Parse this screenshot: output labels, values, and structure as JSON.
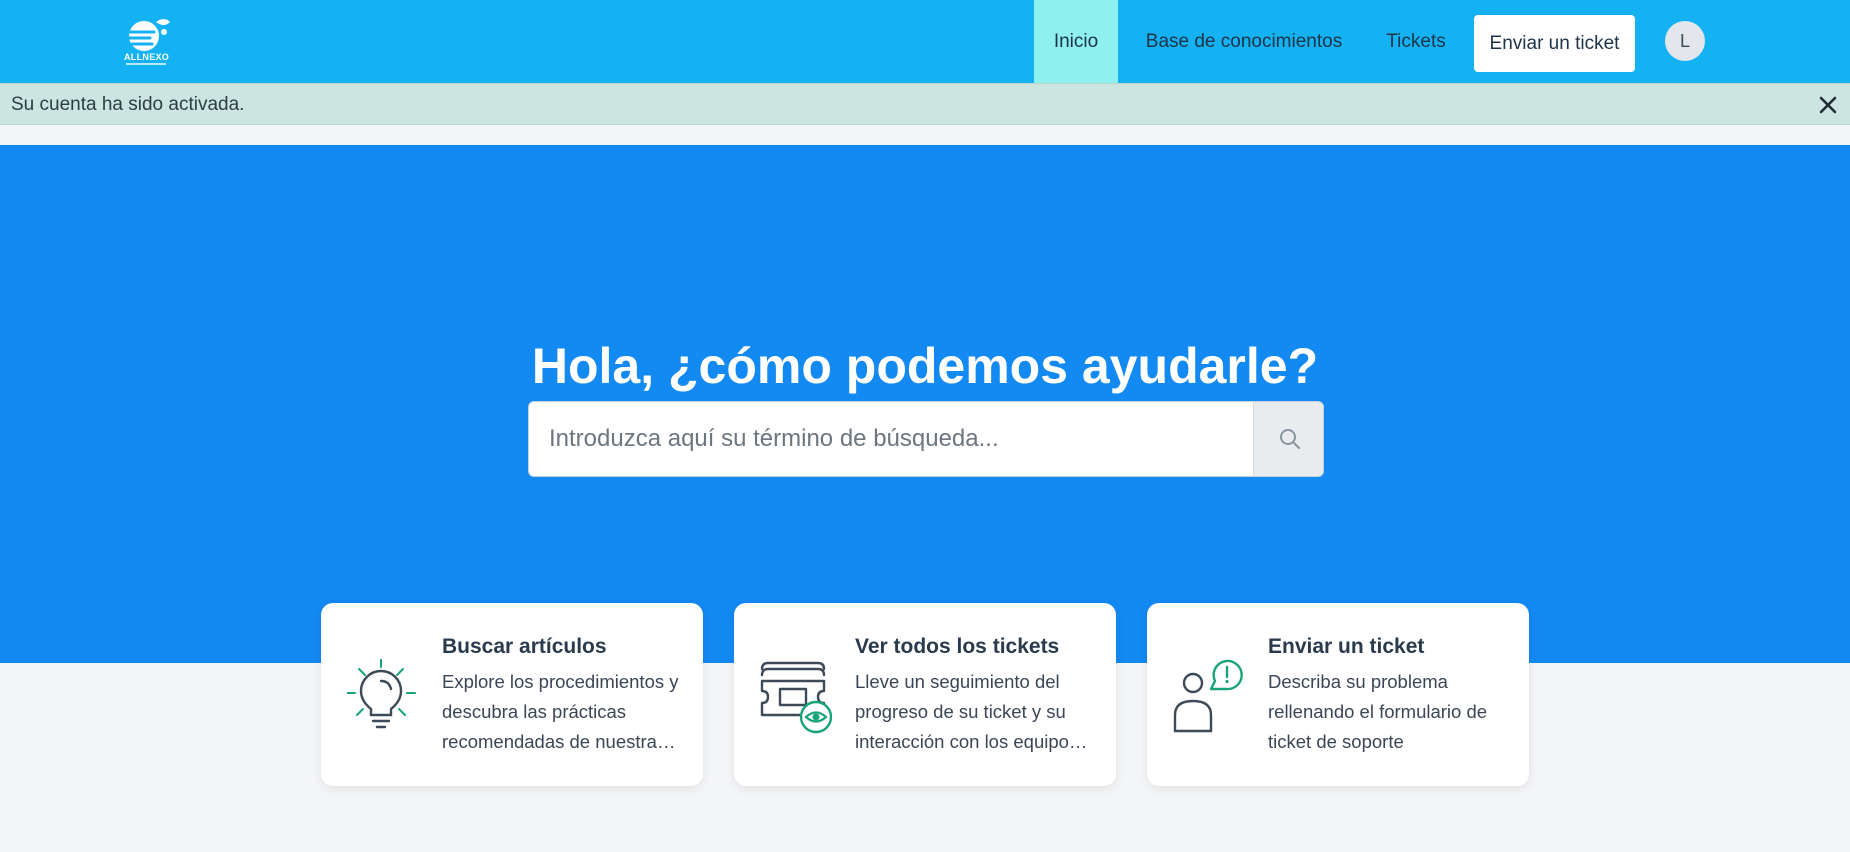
{
  "brand": {
    "name": "ALLNEXO"
  },
  "nav": {
    "items": [
      {
        "label": "Inicio",
        "active": true
      },
      {
        "label": "Base de conocimientos",
        "active": false
      },
      {
        "label": "Tickets",
        "active": false
      }
    ],
    "submit_button": "Enviar un ticket",
    "avatar_initial": "L"
  },
  "alert": {
    "message": "Su cuenta ha sido activada."
  },
  "hero": {
    "title": "Hola, ¿cómo podemos ayudarle?",
    "search_placeholder": "Introduzca aquí su término de búsqueda..."
  },
  "cards": [
    {
      "title": "Buscar artículos",
      "desc_lines": [
        "Explore los procedimientos y",
        "descubra las prácticas",
        "recomendadas de nuestra…"
      ],
      "icon": "lightbulb-icon"
    },
    {
      "title": "Ver todos los tickets",
      "desc_lines": [
        "Lleve un seguimiento del",
        "progreso de su ticket y su",
        "interacción con los equipo…"
      ],
      "icon": "ticket-eye-icon"
    },
    {
      "title": "Enviar un ticket",
      "desc_lines": [
        "Describa su problema",
        "rellenando el formulario de",
        "ticket de soporte"
      ],
      "icon": "person-alert-icon"
    }
  ],
  "colors": {
    "topbar": "#14b2f3",
    "active_nav": "#8ff0f0",
    "hero": "#1389f2",
    "alert": "#cde5e0",
    "icon_accent": "#1aa37a"
  }
}
